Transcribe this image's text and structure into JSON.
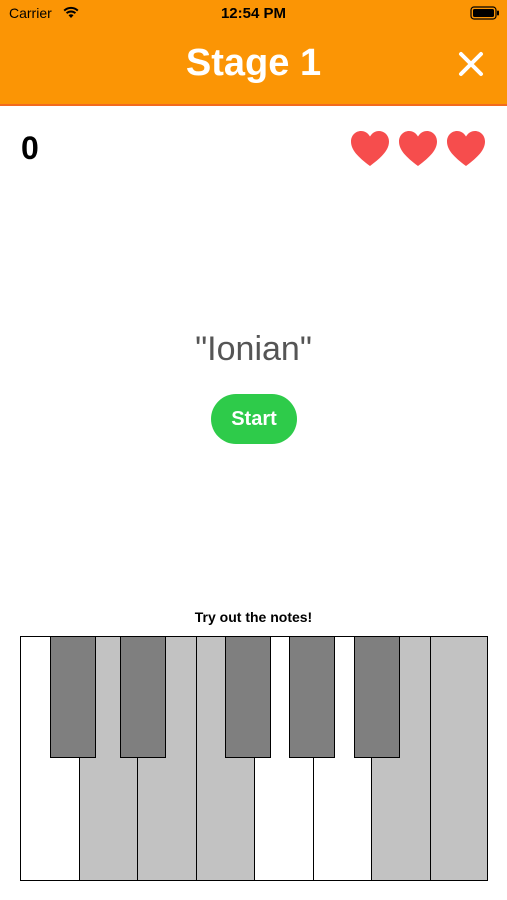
{
  "status_bar": {
    "carrier": "Carrier",
    "time": "12:54 PM"
  },
  "nav": {
    "title": "Stage 1",
    "close_icon": "close-icon"
  },
  "game": {
    "score": "0",
    "lives": 3,
    "mode_name": "\"Ionian\"",
    "start_label": "Start"
  },
  "piano": {
    "caption": "Try out the notes!",
    "white_keys": [
      "white",
      "gray",
      "gray",
      "gray",
      "white",
      "white",
      "gray",
      "gray"
    ],
    "black_keys": 5
  },
  "colors": {
    "header": "#fb9505",
    "start_button": "#2ecb4a",
    "heart": "#f64d4d",
    "black_key": "#7f7f7f",
    "highlighted_white_key": "#c2c2c2"
  }
}
